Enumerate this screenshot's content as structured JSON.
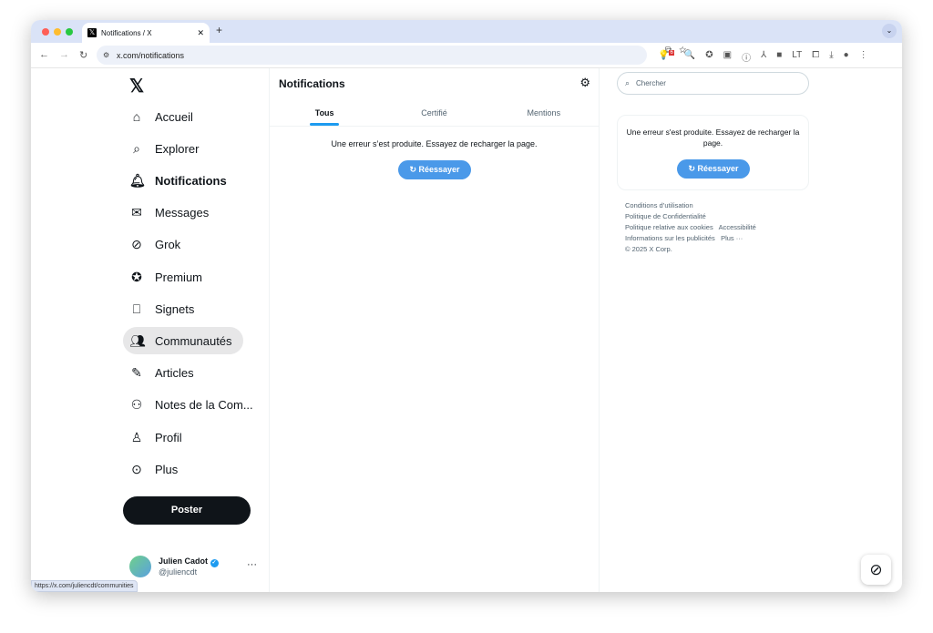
{
  "browser": {
    "tab_title": "Notifications / X",
    "url": "x.com/notifications",
    "status_url": "https://x.com/juliencdt/communities",
    "extension_badge": "6"
  },
  "sidebar": {
    "items": [
      {
        "label": "Accueil",
        "icon": "home-icon"
      },
      {
        "label": "Explorer",
        "icon": "search-icon"
      },
      {
        "label": "Notifications",
        "icon": "bell-icon"
      },
      {
        "label": "Messages",
        "icon": "envelope-icon"
      },
      {
        "label": "Grok",
        "icon": "grok-icon"
      },
      {
        "label": "Premium",
        "icon": "premium-icon"
      },
      {
        "label": "Signets",
        "icon": "bookmark-icon"
      },
      {
        "label": "Communautés",
        "icon": "communities-icon"
      },
      {
        "label": "Articles",
        "icon": "articles-icon"
      },
      {
        "label": "Notes de la Com...",
        "icon": "community-notes-icon"
      },
      {
        "label": "Profil",
        "icon": "person-icon"
      },
      {
        "label": "Plus",
        "icon": "more-circle-icon"
      }
    ],
    "post_label": "Poster",
    "profile": {
      "name": "Julien Cadot",
      "handle": "@juliencdt"
    }
  },
  "main": {
    "title": "Notifications",
    "tabs": [
      "Tous",
      "Certifié",
      "Mentions"
    ],
    "error": "Une erreur s’est produite. Essayez de recharger la page.",
    "retry": "Réessayer"
  },
  "right": {
    "search_placeholder": "Chercher",
    "error": "Une erreur s'est produite. Essayez de recharger la page.",
    "retry": "Réessayer",
    "footer": [
      "Conditions d’utilisation",
      "Politique de Confidentialité",
      "Politique relative aux cookies",
      "Accessibilité",
      "Informations sur les publicités",
      "Plus ···",
      "© 2025 X Corp."
    ]
  },
  "colors": {
    "accent": "#1d9bf0",
    "retry": "#4a99e9",
    "post": "#0f1419"
  }
}
